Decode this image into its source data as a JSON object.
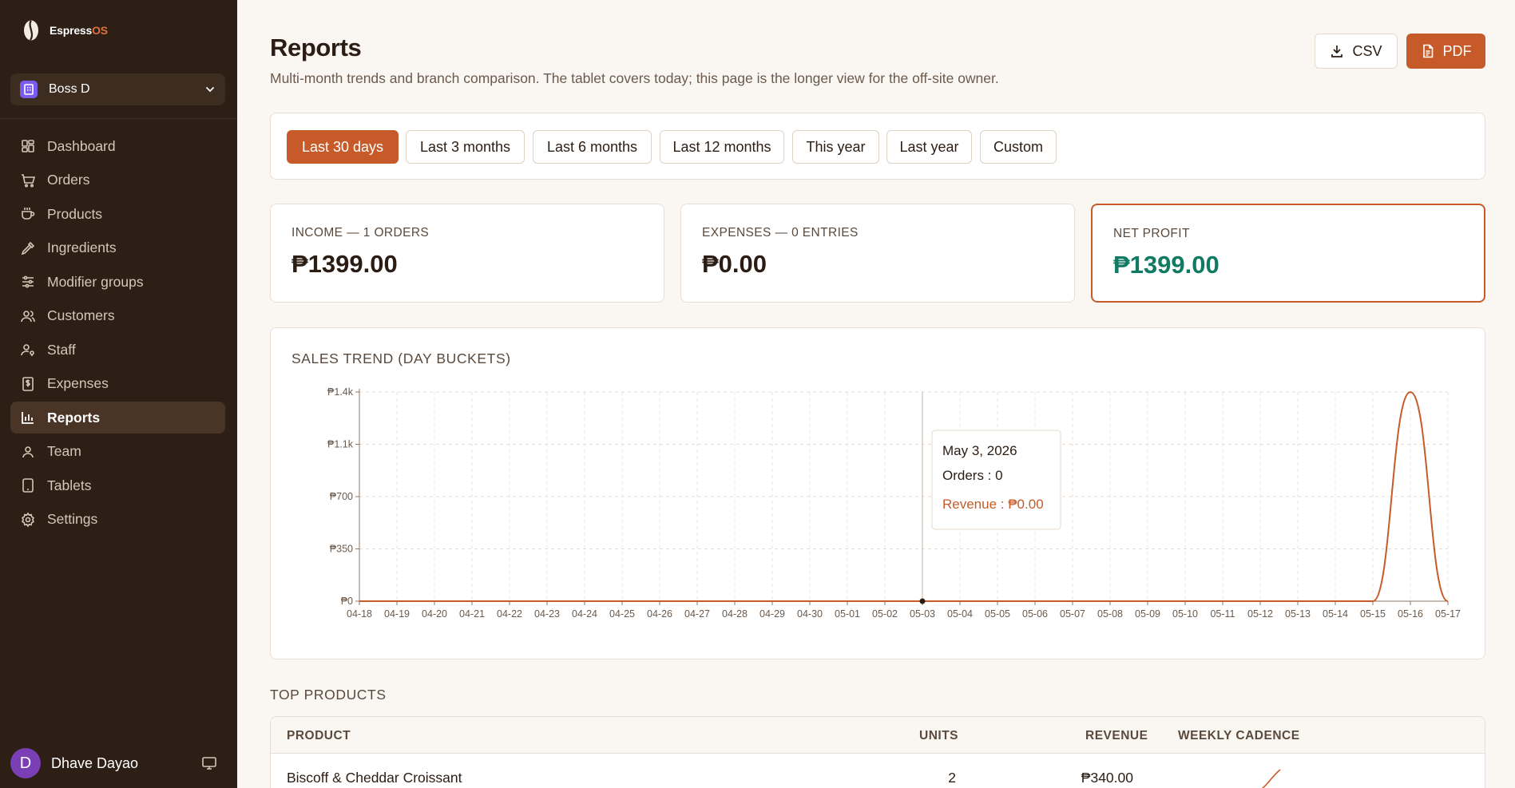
{
  "app": {
    "brand_main": "Espress",
    "brand_accent": "OS"
  },
  "org": {
    "name": "Boss D"
  },
  "nav": [
    {
      "label": "Dashboard",
      "icon": "dashboard-icon"
    },
    {
      "label": "Orders",
      "icon": "cart-icon"
    },
    {
      "label": "Products",
      "icon": "cup-icon"
    },
    {
      "label": "Ingredients",
      "icon": "pipette-icon"
    },
    {
      "label": "Modifier groups",
      "icon": "sliders-icon"
    },
    {
      "label": "Customers",
      "icon": "users-icon"
    },
    {
      "label": "Staff",
      "icon": "user-key-icon"
    },
    {
      "label": "Expenses",
      "icon": "receipt-icon"
    },
    {
      "label": "Reports",
      "icon": "bar-chart-icon",
      "active": true
    },
    {
      "label": "Team",
      "icon": "team-icon"
    },
    {
      "label": "Tablets",
      "icon": "tablet-icon"
    },
    {
      "label": "Settings",
      "icon": "gear-icon"
    }
  ],
  "user": {
    "initial": "D",
    "name": "Dhave Dayao"
  },
  "header": {
    "title": "Reports",
    "subtitle": "Multi-month trends and branch comparison. The tablet covers today; this page is the longer view for the off-site owner.",
    "csv_label": "CSV",
    "pdf_label": "PDF"
  },
  "ranges": [
    "Last 30 days",
    "Last 3 months",
    "Last 6 months",
    "Last 12 months",
    "This year",
    "Last year",
    "Custom"
  ],
  "active_range": "Last 30 days",
  "stats": {
    "income": {
      "label": "INCOME — 1 ORDERS",
      "value": "₱1399.00"
    },
    "expenses": {
      "label": "EXPENSES — 0 ENTRIES",
      "value": "₱0.00"
    },
    "net": {
      "label": "NET PROFIT",
      "value": "₱1399.00"
    }
  },
  "chart_title": "SALES TREND (DAY BUCKETS)",
  "chart_data": {
    "type": "area",
    "title": "SALES TREND (DAY BUCKETS)",
    "x": [
      "04-18",
      "04-19",
      "04-20",
      "04-21",
      "04-22",
      "04-23",
      "04-24",
      "04-25",
      "04-26",
      "04-27",
      "04-28",
      "04-29",
      "04-30",
      "05-01",
      "05-02",
      "05-03",
      "05-04",
      "05-05",
      "05-06",
      "05-07",
      "05-08",
      "05-09",
      "05-10",
      "05-11",
      "05-12",
      "05-13",
      "05-14",
      "05-15",
      "05-16",
      "05-17"
    ],
    "series": [
      {
        "name": "Revenue",
        "values": [
          0,
          0,
          0,
          0,
          0,
          0,
          0,
          0,
          0,
          0,
          0,
          0,
          0,
          0,
          0,
          0,
          0,
          0,
          0,
          0,
          0,
          0,
          0,
          0,
          0,
          0,
          0,
          0,
          1399,
          0
        ]
      }
    ],
    "yticks": [
      "₱0",
      "₱350",
      "₱700",
      "₱1.1k",
      "₱1.4k"
    ],
    "ytick_values": [
      0,
      350,
      700,
      1050,
      1400
    ],
    "ylim": [
      0,
      1400
    ],
    "grid": true,
    "line_color": "#c65b29",
    "tooltip": {
      "date": "May 3, 2026",
      "orders": "Orders : 0",
      "revenue": "Revenue : ₱0.00"
    }
  },
  "top_products": {
    "title": "TOP PRODUCTS",
    "columns": [
      "PRODUCT",
      "UNITS",
      "REVENUE",
      "WEEKLY CADENCE"
    ],
    "rows": [
      {
        "product": "Biscoff & Cheddar Croissant",
        "units": "2",
        "revenue": "₱340.00"
      }
    ]
  }
}
